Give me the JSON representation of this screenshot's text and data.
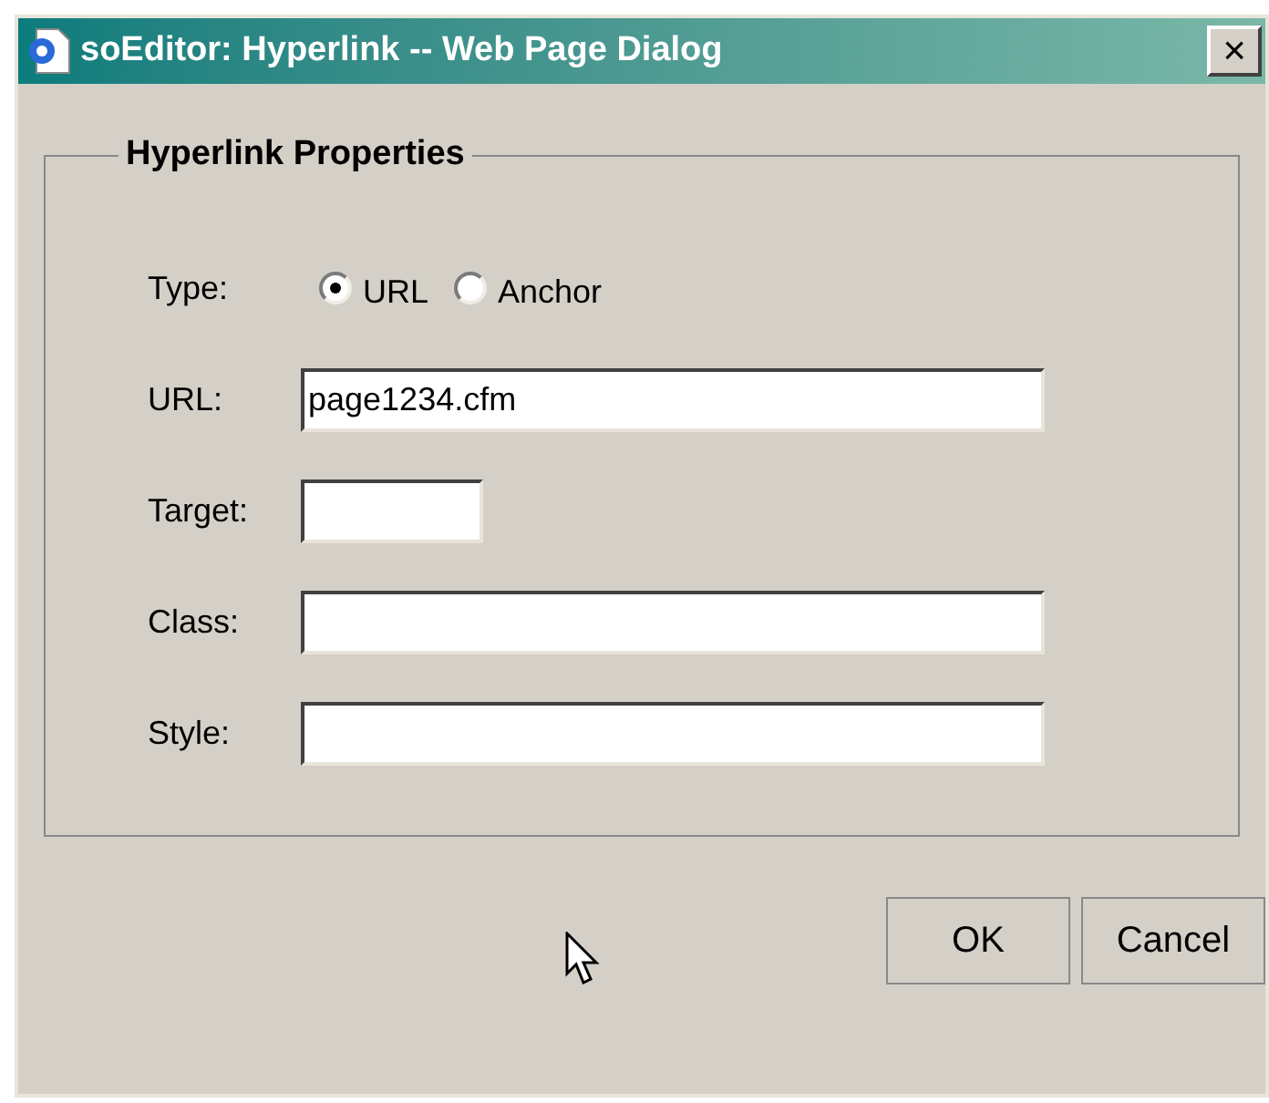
{
  "window": {
    "title": "soEditor: Hyperlink -- Web Page Dialog",
    "close": "×"
  },
  "group": {
    "legend": "Hyperlink Properties"
  },
  "type_row": {
    "label": "Type:",
    "options": [
      {
        "label": "URL",
        "selected": true
      },
      {
        "label": "Anchor",
        "selected": false
      }
    ]
  },
  "fields": [
    {
      "label": "URL:",
      "value": "page1234.cfm",
      "kind": "wide"
    },
    {
      "label": "Target:",
      "kind": "narrow"
    },
    {
      "label": "Class:",
      "kind": "wide"
    },
    {
      "label": "Style:",
      "kind": "wide"
    }
  ],
  "buttons": [
    "OK",
    "Cancel"
  ]
}
